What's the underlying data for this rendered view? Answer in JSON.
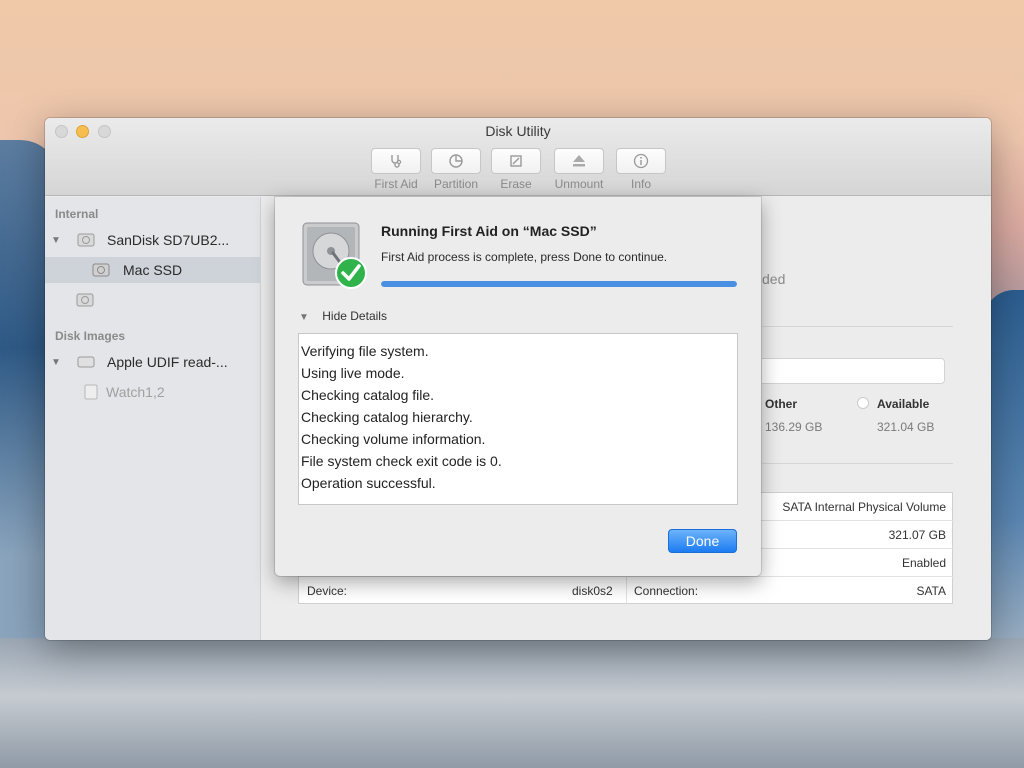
{
  "window": {
    "title": "Disk Utility"
  },
  "toolbar": [
    {
      "label": "First Aid",
      "icon": "stethoscope-icon"
    },
    {
      "label": "Partition",
      "icon": "pie-icon"
    },
    {
      "label": "Erase",
      "icon": "erase-icon"
    },
    {
      "label": "Unmount",
      "icon": "eject-icon"
    },
    {
      "label": "Info",
      "icon": "info-icon"
    }
  ],
  "sidebar": {
    "internal_header": "Internal",
    "items": [
      {
        "label": "SanDisk SD7UB2..."
      },
      {
        "label": "Mac SSD"
      },
      {
        "label": ""
      }
    ],
    "images_header": "Disk Images",
    "image_items": [
      {
        "label": "Apple UDIF read-..."
      },
      {
        "label": "Watch1,2"
      }
    ]
  },
  "background_fragments": {
    "ded": "ded",
    "other_label": "Other",
    "other_value": "136.29 GB",
    "available_label": "Available",
    "available_value": "321.04 GB"
  },
  "info_table": {
    "rows": [
      {
        "right_value": "SATA Internal Physical Volume"
      },
      {
        "right_value": "321.07 GB"
      },
      {
        "right_value": "Enabled"
      },
      {
        "left_label": "Device:",
        "left_value": "disk0s2",
        "right_label": "Connection:",
        "right_value": "SATA"
      }
    ]
  },
  "sheet": {
    "title": "Running First Aid on “Mac SSD”",
    "subtitle": "First Aid process is complete, press Done to continue.",
    "progress": 1.0,
    "details_toggle": "Hide Details",
    "log": [
      "Verifying file system.",
      "Using live mode.",
      "Checking catalog file.",
      "Checking catalog hierarchy.",
      "Checking volume information.",
      "File system check exit code is 0.",
      "Operation successful."
    ],
    "done_label": "Done"
  },
  "colors": {
    "accent": "#4a90e2",
    "success": "#2fb34a",
    "selection": "#cdd3d9"
  }
}
